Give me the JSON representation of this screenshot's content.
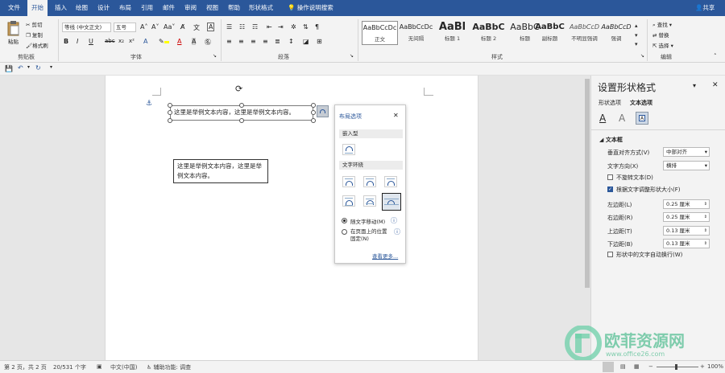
{
  "tabs": [
    {
      "label": "文件",
      "active": false
    },
    {
      "label": "开始",
      "active": true
    },
    {
      "label": "插入",
      "active": false
    },
    {
      "label": "绘图",
      "active": false
    },
    {
      "label": "设计",
      "active": false
    },
    {
      "label": "布局",
      "active": false
    },
    {
      "label": "引用",
      "active": false
    },
    {
      "label": "邮件",
      "active": false
    },
    {
      "label": "审阅",
      "active": false
    },
    {
      "label": "视图",
      "active": false
    },
    {
      "label": "帮助",
      "active": false
    },
    {
      "label": "形状格式",
      "active": false
    }
  ],
  "tell_me": "操作说明搜索",
  "share": "共享",
  "clipboard": {
    "paste": "粘贴",
    "cut": "剪切",
    "copy": "复制",
    "format_painter": "格式刷",
    "group": "剪贴板"
  },
  "font": {
    "name": "等线 (中文正文)",
    "size": "五号",
    "group": "字体"
  },
  "paragraph": {
    "group": "段落"
  },
  "styles": {
    "group": "样式",
    "items": [
      {
        "preview": "AaBbCcDc",
        "name": "正文"
      },
      {
        "preview": "AaBbCcDc",
        "name": "无间隔"
      },
      {
        "preview": "AaBl",
        "name": "标题 1"
      },
      {
        "preview": "AaBbC",
        "name": "标题 2"
      },
      {
        "preview": "AaBbC",
        "name": "标题"
      },
      {
        "preview": "AaBbC",
        "name": "副标题"
      },
      {
        "preview": "AaBbCcD",
        "name": "不明显强调"
      },
      {
        "preview": "AaBbCcD",
        "name": "强调"
      }
    ]
  },
  "editing": {
    "find": "查找",
    "replace": "替换",
    "select": "选择",
    "group": "编辑"
  },
  "doc": {
    "textbox1": "这里是举例文本内容，这里是举例文本内容。",
    "textbox2": "这里是举例文本内容，这里是举例文本内容。"
  },
  "layout_options": {
    "title": "布局选项",
    "inline": "嵌入型",
    "wrap": "文字环绕",
    "move_with_text": "随文字移动(M)",
    "fix_position": "在页面上的位置固定(N)",
    "see_more": "查看更多..."
  },
  "pane": {
    "title": "设置形状格式",
    "tab_shape": "形状选项",
    "tab_text": "文本选项",
    "section": "文本框",
    "vertical_align_label": "垂直对齐方式(V)",
    "vertical_align_value": "中部对齐",
    "direction_label": "文字方向(X)",
    "direction_value": "横排",
    "no_rotate": "不旋转文本(D)",
    "resize": "根据文字调整形状大小(F)",
    "left_label": "左边距(L)",
    "left_value": "0.25 厘米",
    "right_label": "右边距(R)",
    "right_value": "0.25 厘米",
    "top_label": "上边距(T)",
    "top_value": "0.13 厘米",
    "bottom_label": "下边距(B)",
    "bottom_value": "0.13 厘米",
    "wrap_text": "形状中的文字自动换行(W)"
  },
  "status": {
    "page": "第 2 页，共 2 页",
    "words": "20/531 个字",
    "lang": "中文(中国)",
    "access": "辅助功能: 调查",
    "zoom": "100%"
  },
  "watermark": "欧菲资源网",
  "watermark_url": "www.office26.com",
  "colors": {
    "accent": "#2b579a",
    "highlight": "#ffff00",
    "font_color": "#ff0000"
  }
}
